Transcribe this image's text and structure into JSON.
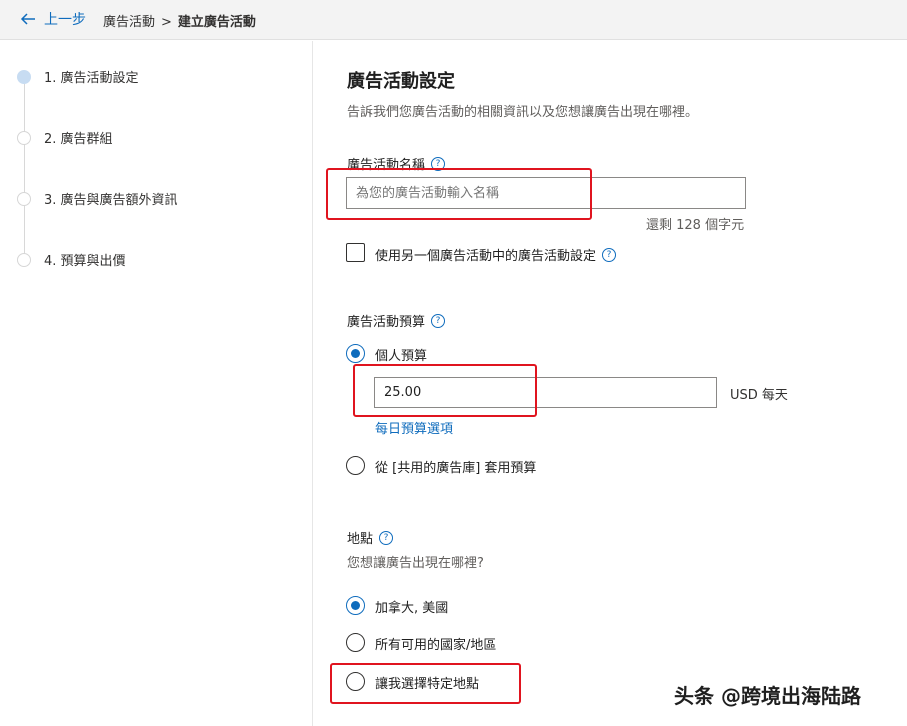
{
  "header": {
    "back_label": "上一步",
    "breadcrumb": [
      "廣告活動",
      "建立廣告活動"
    ],
    "separator": ">"
  },
  "steps": [
    {
      "label": "1. 廣告活動設定",
      "active": true
    },
    {
      "label": "2. 廣告群組",
      "active": false
    },
    {
      "label": "3. 廣告與廣告額外資訊",
      "active": false
    },
    {
      "label": "4. 預算與出價",
      "active": false
    }
  ],
  "main": {
    "title": "廣告活動設定",
    "subtitle": "告訴我們您廣告活動的相關資訊以及您想讓廣告出現在哪裡。",
    "campaign_name": {
      "label": "廣告活動名稱",
      "placeholder": "為您的廣告活動輸入名稱",
      "value": "",
      "counter": "還剩 128 個字元"
    },
    "copy_settings_label": "使用另一個廣告活動中的廣告活動設定",
    "copy_settings_checked": false,
    "budget": {
      "label": "廣告活動預算",
      "options": [
        {
          "label": "個人預算",
          "selected": true
        },
        {
          "label": "從 [共用的廣告庫] 套用預算",
          "selected": false
        }
      ],
      "amount": "25.00",
      "unit": "USD  每天",
      "daily_options_link": "每日預算選項"
    },
    "location": {
      "label": "地點",
      "question": "您想讓廣告出現在哪裡?",
      "options": [
        {
          "label": "加拿大, 美國",
          "selected": true
        },
        {
          "label": "所有可用的國家/地區",
          "selected": false
        },
        {
          "label": "讓我選擇特定地點",
          "selected": false
        }
      ]
    }
  },
  "watermark": "头条 @跨境出海陆路",
  "colors": {
    "accent": "#0f6cbd",
    "highlight": "#e0141f",
    "active_step": "#c7dcf2"
  },
  "icons": {
    "back": "arrow-left-icon",
    "help": "question-circle-icon"
  }
}
